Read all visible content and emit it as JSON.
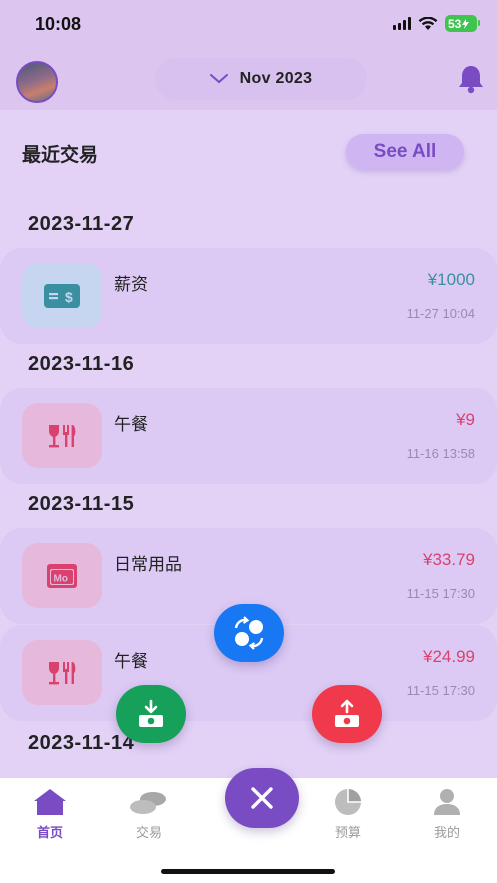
{
  "status_bar": {
    "time": "10:08",
    "battery": "53"
  },
  "header": {
    "month": "Nov 2023"
  },
  "section": {
    "title": "最近交易",
    "see_all": "See All"
  },
  "groups": [
    {
      "date": "2023-11-27",
      "transactions": [
        {
          "name": "薪资",
          "amount": "¥1000",
          "time": "11-27 10:04",
          "icon": "salary-icon",
          "kind": "income"
        }
      ]
    },
    {
      "date": "2023-11-16",
      "transactions": [
        {
          "name": "午餐",
          "amount": "¥9",
          "time": "11-16 13:58",
          "icon": "dining-icon",
          "kind": "expense"
        }
      ]
    },
    {
      "date": "2023-11-15",
      "transactions": [
        {
          "name": "日常用品",
          "amount": "¥33.79",
          "time": "11-15 17:30",
          "icon": "wallet-mo-icon",
          "kind": "expense"
        },
        {
          "name": "午餐",
          "amount": "¥24.99",
          "time": "11-15 17:30",
          "icon": "dining-icon",
          "kind": "expense"
        }
      ]
    },
    {
      "date": "2023-11-14",
      "transactions": []
    }
  ],
  "nav": {
    "home": "首页",
    "transactions": "交易",
    "budget": "预算",
    "mine": "我的"
  },
  "colors": {
    "accent": "#7a4cc4",
    "income": "#3a8fa0",
    "expense": "#d9426e",
    "fab_transfer": "#1877f2",
    "fab_income": "#16a05a",
    "fab_expense": "#f0394a"
  }
}
